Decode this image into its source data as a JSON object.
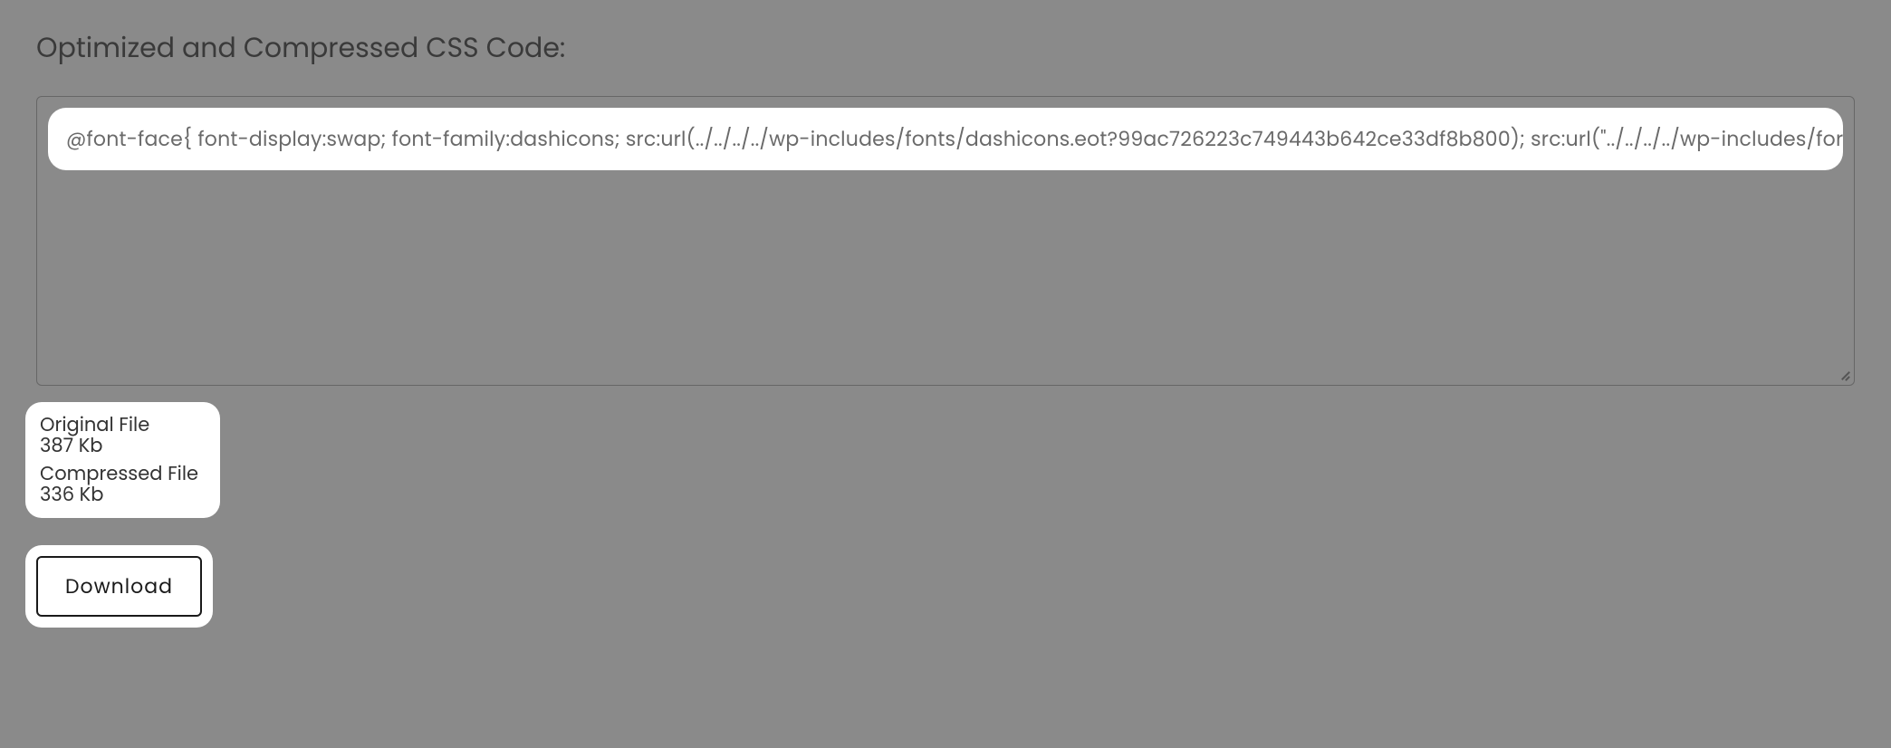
{
  "section": {
    "title": "Optimized and Compressed CSS Code:"
  },
  "code": {
    "content": "@font-face{ font-display:swap; font-family:dashicons; src:url(../../../../wp-includes/fonts/dashicons.eot?99ac726223c749443b642ce33df8b800); src:url(\"../../../../wp-includes/for"
  },
  "fileInfo": {
    "original": {
      "label": "Original File",
      "size": "387 Kb"
    },
    "compressed": {
      "label": "Compressed File",
      "size": "336 Kb"
    }
  },
  "actions": {
    "download": "Download"
  }
}
